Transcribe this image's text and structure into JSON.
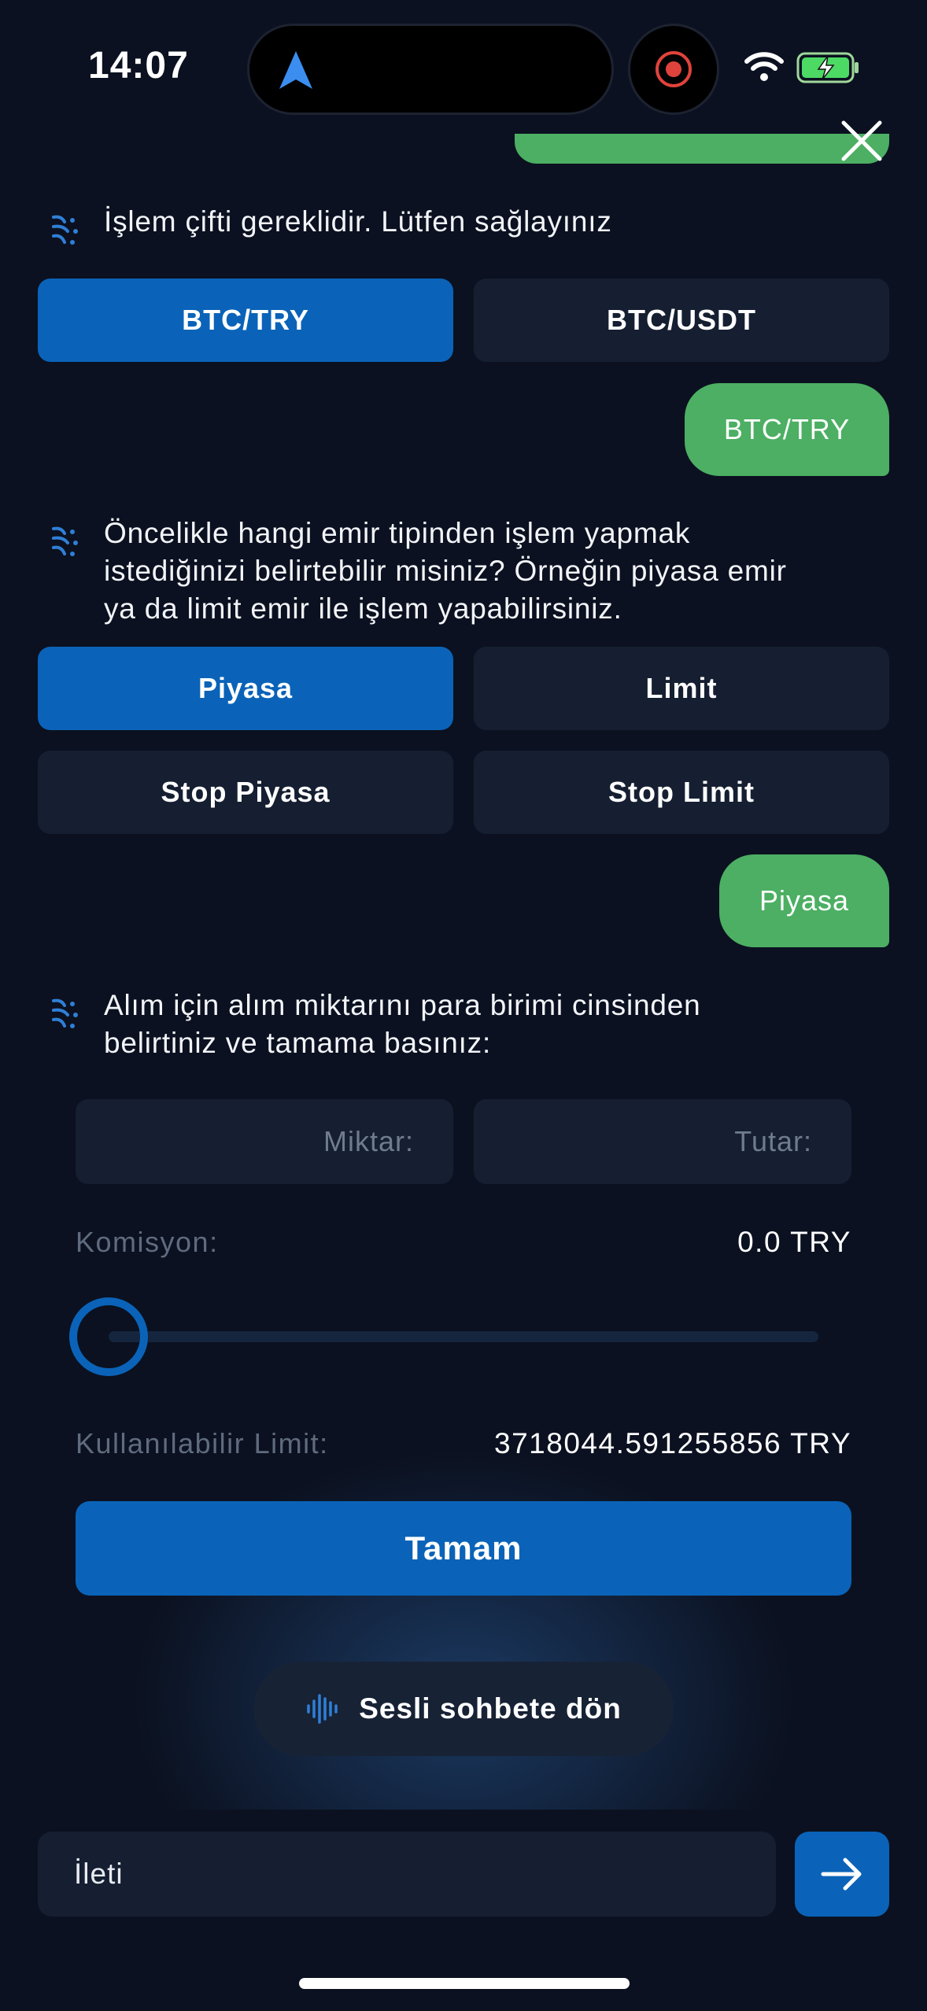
{
  "status_bar": {
    "time": "14:07"
  },
  "chat": {
    "q1": "İşlem çifti gereklidir. Lütfen sağlayınız",
    "q1_options": [
      "BTC/TRY",
      "BTC/USDT"
    ],
    "a1": "BTC/TRY",
    "q2_lines": [
      "Öncelikle hangi emir tipinden işlem yapmak",
      "istediğinizi belirtebilir misiniz? Örneğin piyasa emir",
      "ya da limit emir ile işlem yapabilirsiniz."
    ],
    "q2_options": [
      "Piyasa",
      "Limit",
      "Stop Piyasa",
      "Stop Limit"
    ],
    "a2": "Piyasa",
    "q3_lines": [
      "Alım için alım miktarını para birimi cinsinden",
      "belirtiniz ve tamama basınız:"
    ]
  },
  "form": {
    "amount_placeholder": "Miktar:",
    "total_placeholder": "Tutar:",
    "commission_label": "Komisyon:",
    "commission_value": "0.0 TRY",
    "slider_value_percent": 0,
    "limit_label": "Kullanılabilir Limit:",
    "limit_value": "3718044.591255856 TRY",
    "submit_label": "Tamam"
  },
  "voice_button_label": "Sesli sohbete dön",
  "composer": {
    "placeholder": "İleti"
  },
  "colors": {
    "accent": "#0a63b8",
    "user_bubble": "#4caf63",
    "background": "#0b1120"
  }
}
